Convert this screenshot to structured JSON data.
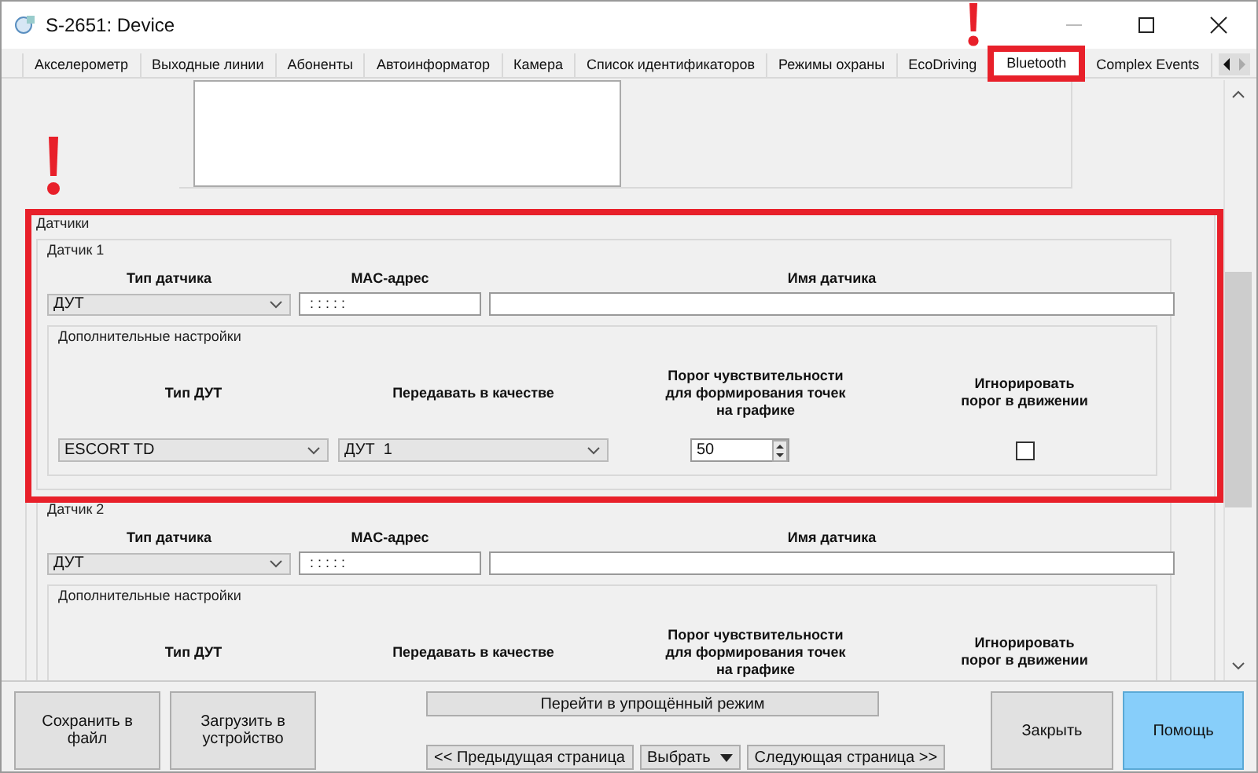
{
  "window": {
    "title": "S-2651: Device"
  },
  "tabs": [
    {
      "label": "Акселерометр",
      "selected": false
    },
    {
      "label": "Выходные линии",
      "selected": false
    },
    {
      "label": "Абоненты",
      "selected": false
    },
    {
      "label": "Автоинформатор",
      "selected": false
    },
    {
      "label": "Камера",
      "selected": false
    },
    {
      "label": "Список идентификаторов",
      "selected": false
    },
    {
      "label": "Режимы охраны",
      "selected": false
    },
    {
      "label": "EcoDriving",
      "selected": false
    },
    {
      "label": "Bluetooth",
      "selected": true
    },
    {
      "label": "Complex Events",
      "selected": false
    }
  ],
  "sensors_group": {
    "title": "Датчики",
    "sensors": [
      {
        "title": "Датчик 1",
        "type_label": "Тип датчика",
        "mac_label": "MAC-адрес",
        "name_label": "Имя датчика",
        "type": "ДУТ",
        "mac": ": : : : :",
        "extra_title": "Дополнительные настройки",
        "dut_type_label": "Тип ДУТ",
        "transmit_label": "Передавать в качестве",
        "threshold_label": "Порог чувствительности для формирования точек на графике",
        "ignore_label": "Игнорировать порог в движении",
        "dut_type": "ESCORT TD",
        "transmit_as": "ДУТ  1",
        "threshold": "50",
        "ignore_checked": false
      },
      {
        "title": "Датчик 2",
        "type_label": "Тип датчика",
        "mac_label": "MAC-адрес",
        "name_label": "Имя датчика",
        "type": "ДУТ",
        "mac": ": : : : :",
        "extra_title": "Дополнительные настройки",
        "dut_type_label": "Тип ДУТ",
        "transmit_label": "Передавать в качестве",
        "threshold_label": "Порог чувствительности для формирования точек на графике",
        "ignore_label": "Игнорировать порог в движении"
      }
    ]
  },
  "buttons": {
    "save": "Сохранить в файл",
    "load": "Загрузить в устройство",
    "simple_mode": "Перейти в упрощённый режим",
    "prev": "<< Предыдущая страница",
    "choose": "Выбрать",
    "next": "Следующая страница >>",
    "close": "Закрыть",
    "help": "Помощь"
  }
}
